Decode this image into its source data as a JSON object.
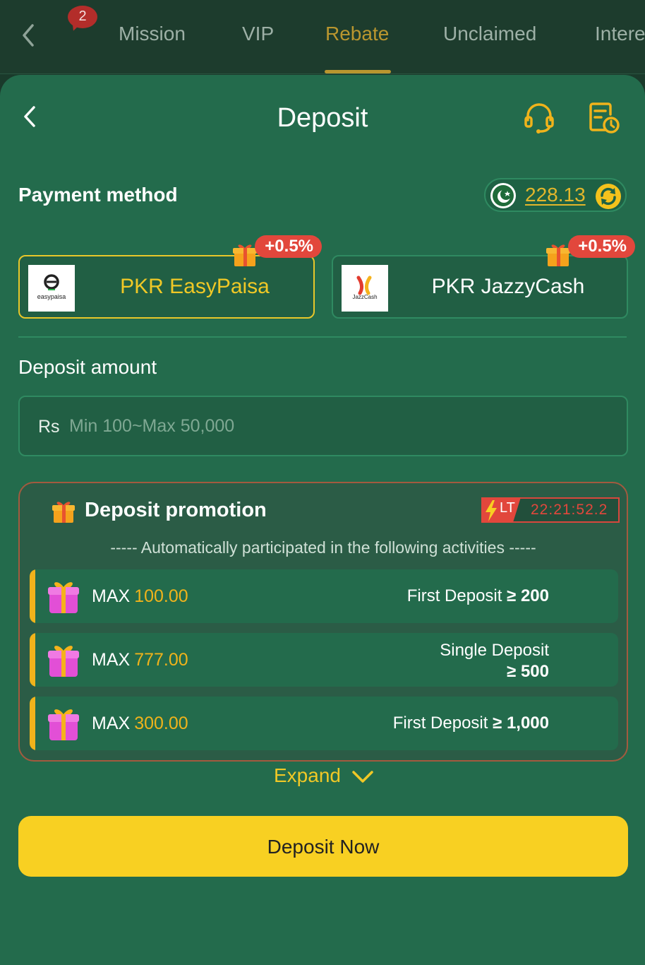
{
  "topnav": {
    "notification_count": "2",
    "tabs": [
      {
        "label": "Mission"
      },
      {
        "label": "VIP"
      },
      {
        "label": "Rebate",
        "active": true
      },
      {
        "label": "Unclaimed"
      },
      {
        "label": "Intere"
      }
    ]
  },
  "header": {
    "title": "Deposit"
  },
  "payment": {
    "label": "Payment method",
    "balance": "228.13",
    "methods": [
      {
        "name": "PKR EasyPaisa",
        "bonus": "+0.5%",
        "logo_text": "easypaisa",
        "selected": true
      },
      {
        "name": "PKR JazzyCash",
        "bonus": "+0.5%",
        "logo_text": "JazzCash",
        "selected": false
      }
    ]
  },
  "amount": {
    "label": "Deposit amount",
    "currency": "Rs",
    "placeholder": "Min 100~Max 50,000"
  },
  "promotion": {
    "title": "Deposit promotion",
    "lt_label": "LT",
    "timer": "22:21:52.2",
    "subtitle": "----- Automatically participated in the following activities -----",
    "items": [
      {
        "max_label": "MAX",
        "max_value": "100.00",
        "cond_text": "First Deposit",
        "cond_op": "≥",
        "cond_value": "200"
      },
      {
        "max_label": "MAX",
        "max_value": "777.00",
        "cond_text": "Single Deposit",
        "cond_op": "≥",
        "cond_value": "500"
      },
      {
        "max_label": "MAX",
        "max_value": "300.00",
        "cond_text": "First Deposit",
        "cond_op": "≥",
        "cond_value": "1,000"
      }
    ]
  },
  "expand_label": "Expand",
  "deposit_button": "Deposit Now",
  "colors": {
    "accent": "#f8d022",
    "background": "#236b4c",
    "highlight": "#f0b31b",
    "bonus_badge": "#e2473c"
  }
}
